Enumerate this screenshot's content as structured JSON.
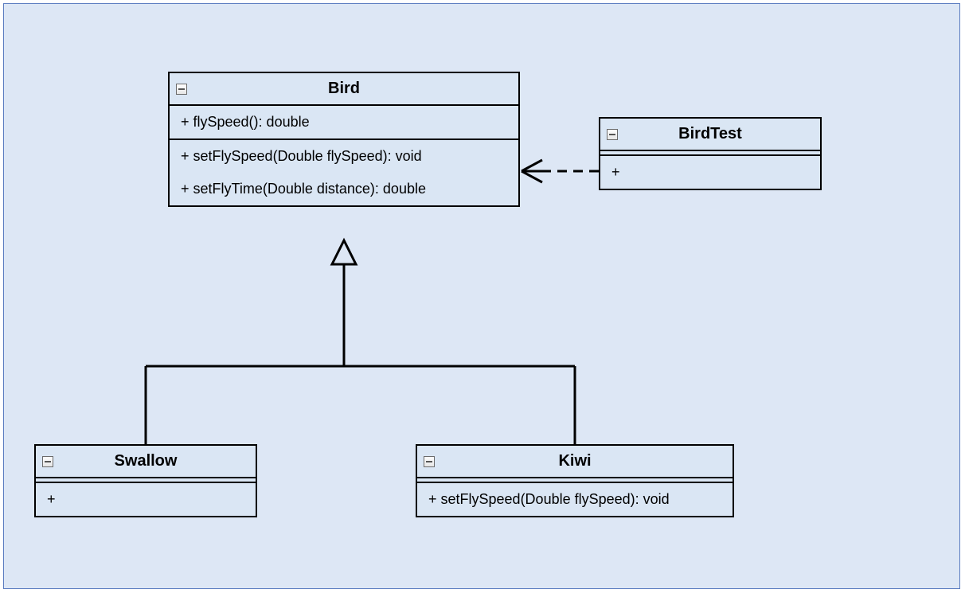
{
  "diagram": {
    "type": "uml-class-diagram",
    "classes": {
      "bird": {
        "name": "Bird",
        "attributes": [
          "+ flySpeed(): double"
        ],
        "methods": [
          "+ setFlySpeed(Double flySpeed): void",
          "+ setFlyTime(Double distance): double"
        ]
      },
      "birdTest": {
        "name": "BirdTest",
        "attributes": [],
        "methods": [
          "+"
        ]
      },
      "swallow": {
        "name": "Swallow",
        "attributes": [],
        "methods": [
          "+"
        ]
      },
      "kiwi": {
        "name": "Kiwi",
        "attributes": [],
        "methods": [
          "+ setFlySpeed(Double flySpeed): void"
        ]
      }
    },
    "relationships": [
      {
        "from": "swallow",
        "to": "bird",
        "type": "generalization"
      },
      {
        "from": "kiwi",
        "to": "bird",
        "type": "generalization"
      },
      {
        "from": "birdTest",
        "to": "bird",
        "type": "dependency"
      }
    ]
  }
}
